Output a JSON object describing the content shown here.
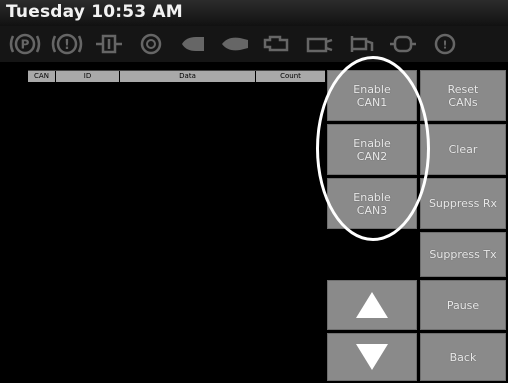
{
  "status": {
    "clock": "Tuesday 10:53 AM"
  },
  "indicators": [
    {
      "name": "parking-brake-icon",
      "text": "(P)"
    },
    {
      "name": "warning-triangle-icon",
      "text": "!"
    },
    {
      "name": "coolant-temperature-icon",
      "text": ""
    },
    {
      "name": "brake-system-icon",
      "text": ""
    },
    {
      "name": "headlight-icon",
      "text": ""
    },
    {
      "name": "high-beam-icon",
      "text": ""
    },
    {
      "name": "engine-icon",
      "text": ""
    },
    {
      "name": "fan-icon",
      "text": ""
    },
    {
      "name": "fuel-pump-icon",
      "text": ""
    },
    {
      "name": "battery-icon",
      "text": ""
    },
    {
      "name": "tire-pressure-icon",
      "text": ""
    }
  ],
  "table": {
    "headers": {
      "can": "CAN",
      "id": "ID",
      "data": "Data",
      "count": "Count"
    }
  },
  "buttons": {
    "enable_can1": [
      "Enable",
      "CAN1"
    ],
    "enable_can2": [
      "Enable",
      "CAN2"
    ],
    "enable_can3": [
      "Enable",
      "CAN3"
    ],
    "reset_cans": [
      "Reset",
      "CANs"
    ],
    "clear": "Clear",
    "suppress_rx": "Suppress Rx",
    "suppress_tx": "Suppress Tx",
    "pause": "Pause",
    "back": "Back"
  },
  "colors": {
    "button_gray": "#8a8a8a",
    "header_gray": "#a9a9a9",
    "background": "#000000"
  }
}
